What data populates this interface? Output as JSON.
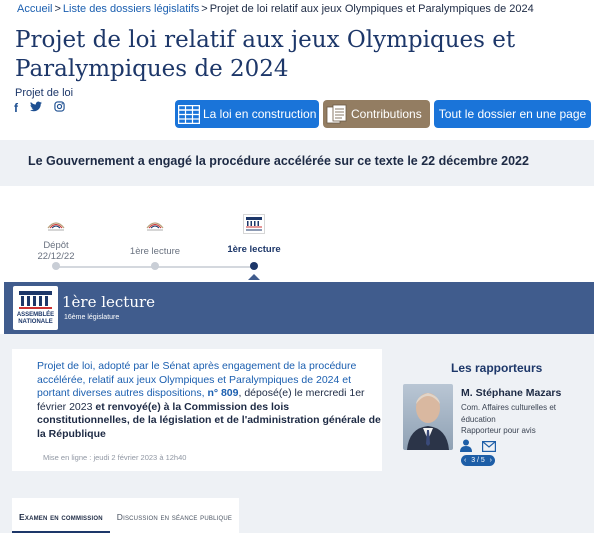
{
  "breadcrumb": {
    "home": "Accueil",
    "dossiers": "Liste des dossiers législatifs",
    "current": "Projet de loi relatif aux jeux Olympiques et Paralympiques de 2024",
    "sep": ">"
  },
  "page": {
    "title": "Projet de loi relatif aux jeux Olympiques et Paralympiques de 2024",
    "subtitle": "Projet de loi"
  },
  "social": [
    "facebook-icon",
    "twitter-icon",
    "instagram-icon"
  ],
  "actions": {
    "construction": "La loi en construction",
    "contributions": "Contributions",
    "full_dossier": "Tout le dossier en une page"
  },
  "banner": {
    "text": "Le Gouvernement a engagé la procédure accélérée sur ce texte le 22 décembre 2022"
  },
  "timeline": {
    "steps": [
      {
        "label": "Dépôt",
        "date": "22/12/22",
        "chamber": "Sénat",
        "active": false
      },
      {
        "label": "1ère lecture",
        "date": "",
        "chamber": "Sénat",
        "active": false
      },
      {
        "label": "1ère lecture",
        "date": "",
        "chamber": "Assemblée nationale",
        "active": true
      }
    ]
  },
  "stage": {
    "logo_text_1": "ASSEMBLÉE",
    "logo_text_2": "NATIONALE",
    "name": "1ère lecture",
    "legislature": "16ème législature"
  },
  "document": {
    "desc_part1": "Projet de loi, adopté par le Sénat après engagement de la procédure accélérée, relatif aux jeux Olympiques et Paralympiques de 2024 et portant diverses autres dispositions,",
    "number": "n° 809",
    "desc_part2": ", déposé(e) le mercredi 1er février 2023",
    "desc_part3": "et renvoyé(e) à la Commission des lois constitutionnelles, de la législation et de l'administration générale de la République",
    "online": "Mise en ligne : jeudi 2 février 2023 à 12h40"
  },
  "rapporteurs": {
    "title": "Les rapporteurs",
    "name": "M. Stéphane Mazars",
    "commission": "Com. Affaires culturelles et éducation",
    "role": "Rapporteur pour avis",
    "pager": "3 / 5",
    "prev": "‹",
    "next": "›"
  },
  "tabs": [
    {
      "label": "Examen en commission",
      "active": true
    },
    {
      "label": "Discussion en séance publique",
      "active": false
    }
  ],
  "colors": {
    "brand_blue": "#1a74d9",
    "navy": "#1d3769",
    "stage_bg": "#405c8d",
    "contrib_brown": "#937d62"
  }
}
